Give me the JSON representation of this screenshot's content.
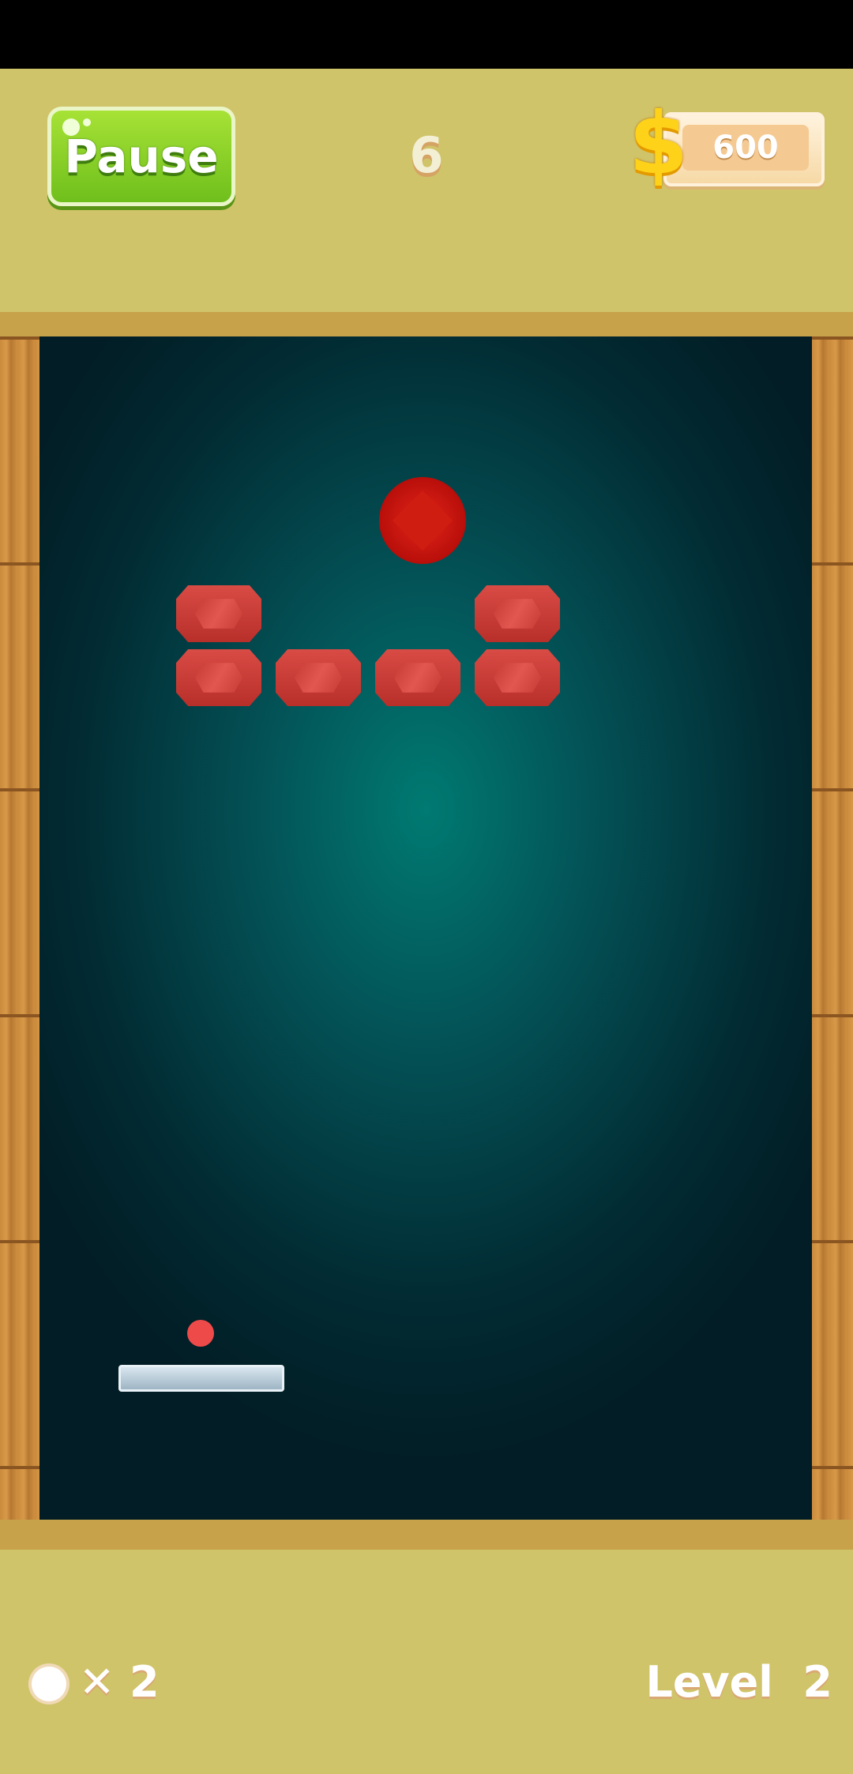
{
  "hud": {
    "pause_label": "Pause",
    "score": "6",
    "coins": "600",
    "coin_icon": "dollar-icon"
  },
  "footer": {
    "lives_label": "✕ 2",
    "level_label": "Level  2"
  },
  "game": {
    "bricks_remaining": 6,
    "brick_color": "#c93630",
    "gem_color": "#d01d12",
    "ball_color": "#ef4a4a",
    "background_center": "#007a72"
  }
}
